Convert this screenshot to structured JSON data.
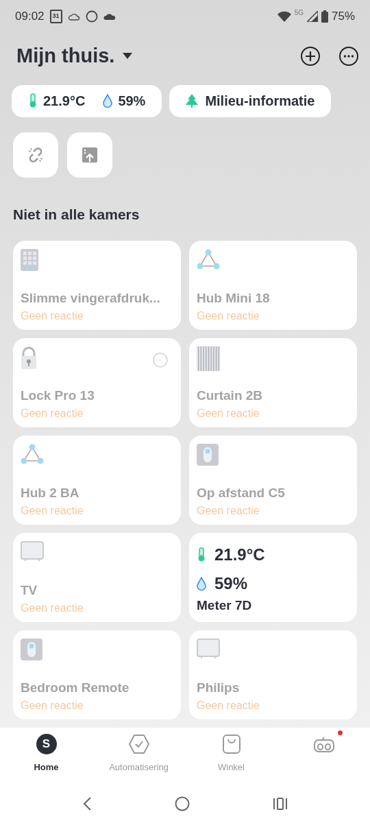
{
  "status_bar": {
    "time": "09:02",
    "calendar_day": "31",
    "network": "5G",
    "battery": "75%"
  },
  "header": {
    "title": "Mijn thuis."
  },
  "chips": [
    {
      "kind": "climate",
      "temperature": "21.9°C",
      "humidity": "59%"
    },
    {
      "kind": "environment",
      "label": "Milieu-informatie"
    }
  ],
  "section_title": "Niet in alle kamers",
  "devices": [
    {
      "kind": "keypad",
      "name": "Slimme vingerafdruk...",
      "status": "Geen reactie"
    },
    {
      "kind": "hub",
      "name": "Hub Mini 18",
      "status": "Geen reactie"
    },
    {
      "kind": "lock",
      "name": "Lock Pro 13",
      "status": "Geen reactie"
    },
    {
      "kind": "curtain",
      "name": "Curtain 2B",
      "status": "Geen reactie"
    },
    {
      "kind": "hub",
      "name": "Hub 2 BA",
      "status": "Geen reactie"
    },
    {
      "kind": "remote",
      "name": "Op afstand C5",
      "status": "Geen reactie"
    },
    {
      "kind": "tv",
      "name": "TV",
      "status": "Geen reactie"
    },
    {
      "kind": "meter",
      "name": "Meter 7D"
    },
    {
      "kind": "remote",
      "name": "Bedroom Remote",
      "status": "Geen reactie"
    },
    {
      "kind": "tv",
      "name": "Philips",
      "status": "Geen reactie"
    }
  ],
  "meter_readings": [
    {
      "kind": "temperature",
      "value": "21.9°C"
    },
    {
      "kind": "humidity",
      "value": "59%"
    }
  ],
  "bottom_nav": [
    {
      "kind": "home",
      "letter": "S",
      "label": "Home",
      "selected": true
    },
    {
      "kind": "automation",
      "label": "Automatisering",
      "selected": false
    },
    {
      "kind": "shop",
      "label": "Winkel",
      "selected": false
    },
    {
      "kind": "assistant",
      "selected": false,
      "notification": true
    }
  ]
}
